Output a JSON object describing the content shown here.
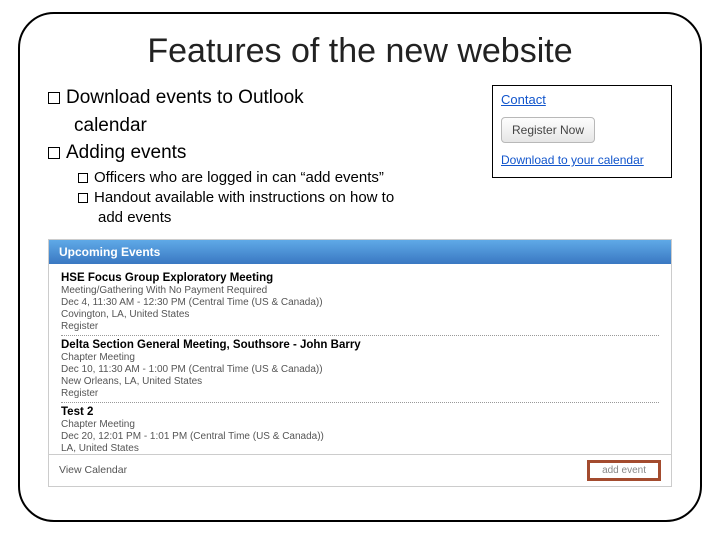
{
  "title": "Features of the new website",
  "bullets": {
    "b1a": "Download events to Outlook",
    "b1b": "calendar",
    "b2": "Adding events",
    "s1": "Officers who are logged in can “add events”",
    "s2a": "Handout available with instructions on how to",
    "s2b": "add events"
  },
  "contact": {
    "heading": "Contact",
    "register_btn": "Register Now",
    "download_link": "Download to your calendar"
  },
  "panel": {
    "header": "Upcoming Events",
    "events": [
      {
        "title": "HSE Focus Group Exploratory Meeting",
        "type": "Meeting/Gathering With No Payment Required",
        "when": "Dec 4, 11:30 AM - 12:30 PM (Central Time (US & Canada))",
        "where": "Covington, LA, United States",
        "register": "Register"
      },
      {
        "title": "Delta Section General Meeting, Southsore - John Barry",
        "type": "Chapter Meeting",
        "when": "Dec 10, 11:30 AM - 1:00 PM (Central Time (US & Canada))",
        "where": "New Orleans, LA, United States",
        "register": "Register"
      },
      {
        "title": "Test 2",
        "type": "Chapter Meeting",
        "when": "Dec 20, 12:01 PM - 1:01 PM (Central Time (US & Canada))",
        "where": "LA, United States",
        "register": ""
      }
    ],
    "view_calendar": "View Calendar",
    "add_event": "add event"
  }
}
